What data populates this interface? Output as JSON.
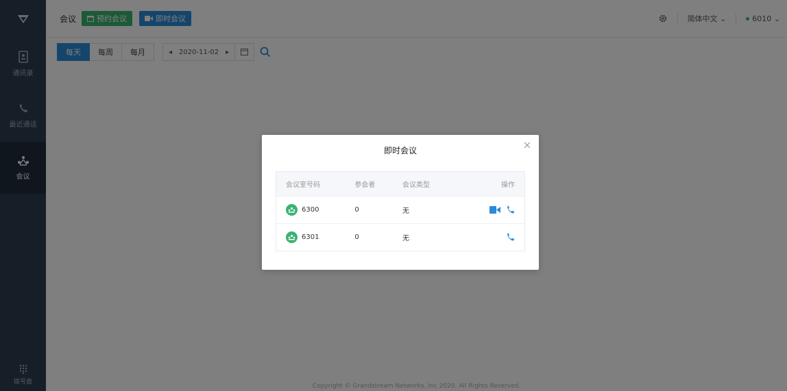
{
  "sidebar": {
    "items": [
      {
        "label": "通讯录",
        "icon": "contacts-icon"
      },
      {
        "label": "最近通话",
        "icon": "recent-calls-icon"
      },
      {
        "label": "会议",
        "icon": "meeting-icon",
        "active": true
      }
    ],
    "dialpad_label": "拨号盘"
  },
  "topbar": {
    "title": "会议",
    "schedule_label": "预约会议",
    "instant_label": "即时会议",
    "language": "简体中文",
    "account": "6010"
  },
  "toolbar": {
    "tabs": [
      "每天",
      "每周",
      "每月"
    ],
    "active_tab": "每天",
    "date": "2020-11-02"
  },
  "footer": {
    "copyright": "Copyright © Grandstream Networks, Inc 2020. All Rights Reserved."
  },
  "modal": {
    "title": "即时会议",
    "columns": [
      "会议室号码",
      "参会者",
      "会议类型",
      "操作"
    ],
    "rows": [
      {
        "room": "6300",
        "participants": "0",
        "type": "无",
        "actions": [
          "video-call",
          "voice-call"
        ]
      },
      {
        "room": "6301",
        "participants": "0",
        "type": "无",
        "actions": [
          "voice-call"
        ]
      }
    ]
  },
  "colors": {
    "sidebar": "#2d3e50",
    "accent_blue": "#2a8ad7",
    "accent_green": "#3bb273"
  }
}
